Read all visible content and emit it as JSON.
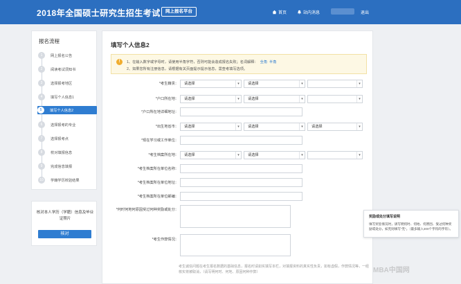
{
  "header": {
    "title": "2018年全国硕士研究生招生考试",
    "platform": "网上报名平台",
    "home": "首页",
    "messages": "站内消息",
    "logout": "退出",
    "accent": "#2c6fc0"
  },
  "sidebar": {
    "title": "报名流程",
    "steps": [
      {
        "num": "1",
        "label": "网上报名公告"
      },
      {
        "num": "2",
        "label": "阅读考试须知书"
      },
      {
        "num": "3",
        "label": "选择报考地区"
      },
      {
        "num": "4",
        "label": "填写个人信息1"
      },
      {
        "num": "5",
        "label": "填写个人信息2"
      },
      {
        "num": "6",
        "label": "选择报考的专业"
      },
      {
        "num": "7",
        "label": "选择报考点"
      },
      {
        "num": "8",
        "label": "校对填报信息"
      },
      {
        "num": "9",
        "label": "完成信息填报"
      },
      {
        "num": "10",
        "label": "学籍学历校验结果"
      }
    ],
    "active_step": 5,
    "active_color": "#2f7dd1"
  },
  "verify": {
    "text": "核对本人学历（学籍）信息及毕业证照片",
    "button": "核对"
  },
  "main": {
    "title": "填写个人信息2",
    "notice": {
      "line1": "1、在输入数字或字母时，请使用半角字符，否则可能会造成报名失败；名词解释：",
      "link1": "全角",
      "link2": "半角",
      "line2": "2、如果您所有注册信息，请根据有关页面提示提示信息，需查考填写选项。"
    },
    "select_placeholder": "请选择",
    "fields": {
      "birthplace": "*考生籍贯：",
      "hukou_location": "*户口所在地：",
      "hukou_address": "*户口所在地详细地址：",
      "birth_city": "*出生地省市：",
      "current_work": "*现在学习或工作单位：",
      "file_location": "*考生档案所在地：",
      "file_unit_name": "*考生档案所在单位名称：",
      "file_unit_address": "*考生档案所在单位地址：",
      "file_unit_postcode": "*考生档案所在单位邮编：",
      "rewards": "*何时何地何原因受过何种奖励或处分：",
      "work_experience": "*考生作弊情况："
    },
    "helper": "考生诚信问题在考生报名数据的基础信息，报名时请如实填写本栏，对填报资料的真实性负责，如有虚假，作弊情况等，一经核实将被取消，（请写明何时、何地、原因何种作弊）"
  },
  "tooltip": {
    "title": "奖励或处分填写说明",
    "body": "填写奖惩情况时，请写明何时、何地、何原因、受过何种奖励或处分，如无则填写“无”。（最多输入200个字符的字符）。"
  },
  "watermark": "MBA中国网"
}
